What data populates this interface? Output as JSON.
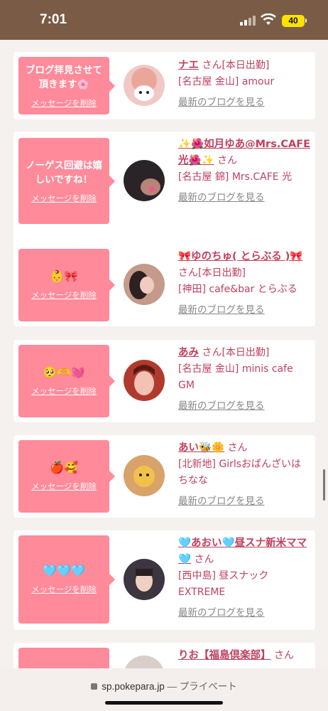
{
  "status": {
    "time": "7:01",
    "battery": "40"
  },
  "browser": {
    "domain": "sp.pokepara.jp",
    "separator": "—",
    "privacy": "プライベート"
  },
  "common": {
    "delete_label": "メッセージを削除",
    "san": "さん",
    "blog_link": "最新のブログを見る"
  },
  "items": [
    {
      "message": "ブログ拝見させて頂きます🌸",
      "name": "ナエ",
      "shift": "[本日出勤]",
      "location": "[名古屋 金山] amour",
      "avatar_color": "#f0c9c6"
    },
    {
      "message": "ノーゲス回避は嬉しいですね！",
      "name": "✨🌺如月ゆあ@Mrs.CAFE光🌺✨",
      "shift": "",
      "location": "[名古屋 錦] Mrs.CAFE 光",
      "avatar_color": "#2a2428"
    },
    {
      "message": "👶🎀",
      "name": "🎀ゆのちゅ( とらぶる )🎀",
      "shift": "[本日出勤]",
      "location": "[神田] cafe&bar とらぶる",
      "avatar_color": "#c49a8a"
    },
    {
      "message": "🥺🫶💓",
      "name": "あみ",
      "shift": "[本日出勤]",
      "location": "[名古屋 金山] minis cafe GM",
      "avatar_color": "#b13a2e"
    },
    {
      "message": "🍎🥰",
      "name": "あい🐝🌼",
      "shift": "",
      "location": "[北新地] Girlsおばんざいはちなな",
      "avatar_color": "#d9a26a"
    },
    {
      "message": "🩵🩵🩵",
      "name": "🩵あおい🩵昼スナ新米ママ🩵",
      "shift": "",
      "location": "[西中島] 昼スナック EXTREME",
      "avatar_color": "#3d3540"
    },
    {
      "message": "💛",
      "name": "りお【福島倶楽部】",
      "shift": "",
      "location": "",
      "avatar_color": "#d7cfc8"
    }
  ]
}
